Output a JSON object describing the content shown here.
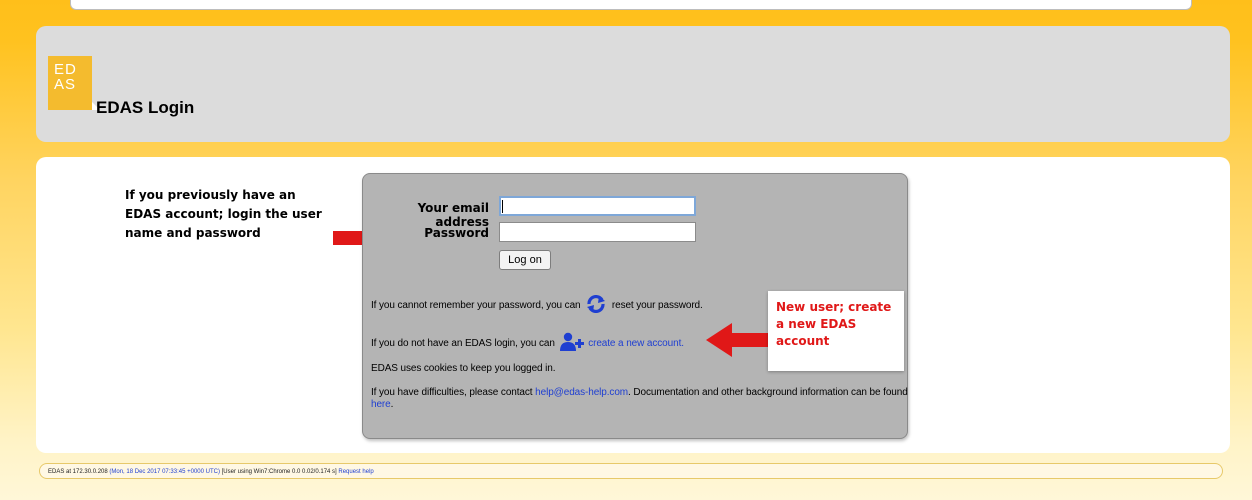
{
  "header": {
    "logo_text": "ED AS",
    "title": "EDAS Login"
  },
  "annotations": {
    "left_note": "If you previously have an EDAS account; login the user name and password",
    "right_note": "New user; create a new EDAS account",
    "arrow_color": "#e01818"
  },
  "login_form": {
    "email_label": "Your email address",
    "email_value": "",
    "password_label": "Password",
    "password_value": "",
    "logon_button": "Log on"
  },
  "info": {
    "reset_prefix": "If you cannot remember your password, you can",
    "reset_icon": "refresh-icon",
    "reset_suffix": "reset your password.",
    "new_prefix": "If you do not have an EDAS login, you can",
    "new_icon": "add-user-icon",
    "new_link": "create a new account.",
    "cookies": "EDAS uses cookies to keep you logged in.",
    "help_prefix": "If you have difficulties, please contact",
    "help_email": "help@edas-help.com",
    "help_middle": ". Documentation and other background information can be found",
    "help_link": "here",
    "help_end": "."
  },
  "footer": {
    "server": "EDAS at 172.30.0.208",
    "timestamp": "(Mon, 18 Dec 2017 07:33:45 +0000 UTC)",
    "user_info": "[User using Win7:Chrome 0.0 0.02/0.174 s]",
    "request_help": "Request help"
  },
  "colors": {
    "link": "#1f3fd1",
    "background_top": "#ffbf1a",
    "header_panel": "#dcdcdc",
    "login_box": "#b4b4b4",
    "logo": "#f4bb2e"
  }
}
